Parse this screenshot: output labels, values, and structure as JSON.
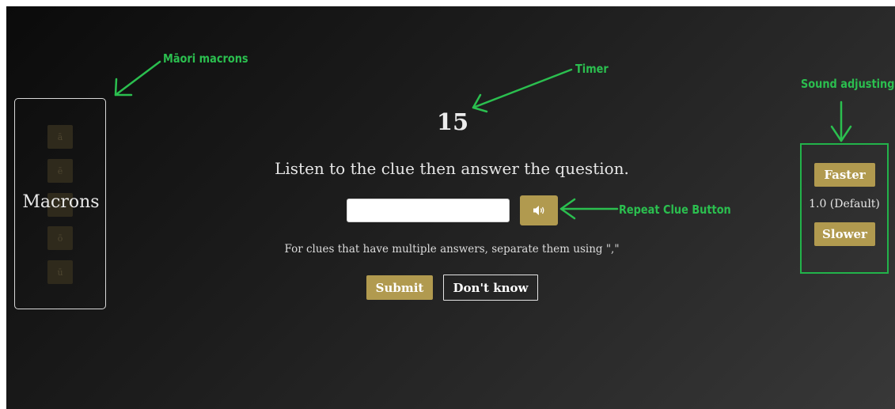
{
  "colors": {
    "accent_gold": "#b19a4f",
    "annotation_green": "#2bbf4f",
    "panel_border": "#d9d9d9"
  },
  "macrons": {
    "label": "Macrons",
    "buttons": [
      "ā",
      "ē",
      "ī",
      "ō",
      "ū"
    ]
  },
  "quiz": {
    "timer": "15",
    "instruction": "Listen to the clue then answer the question.",
    "answer_value": "",
    "repeat_icon": "speaker-icon",
    "hint": "For clues that have multiple answers, separate them using \",\"",
    "submit_label": "Submit",
    "dont_know_label": "Don't know"
  },
  "speed": {
    "faster_label": "Faster",
    "value": "1.0 (Default)",
    "slower_label": "Slower"
  },
  "annotations": {
    "macrons": "Māori macrons",
    "timer": "Timer",
    "sound": "Sound adjusting",
    "repeat": "Repeat Clue Button"
  }
}
